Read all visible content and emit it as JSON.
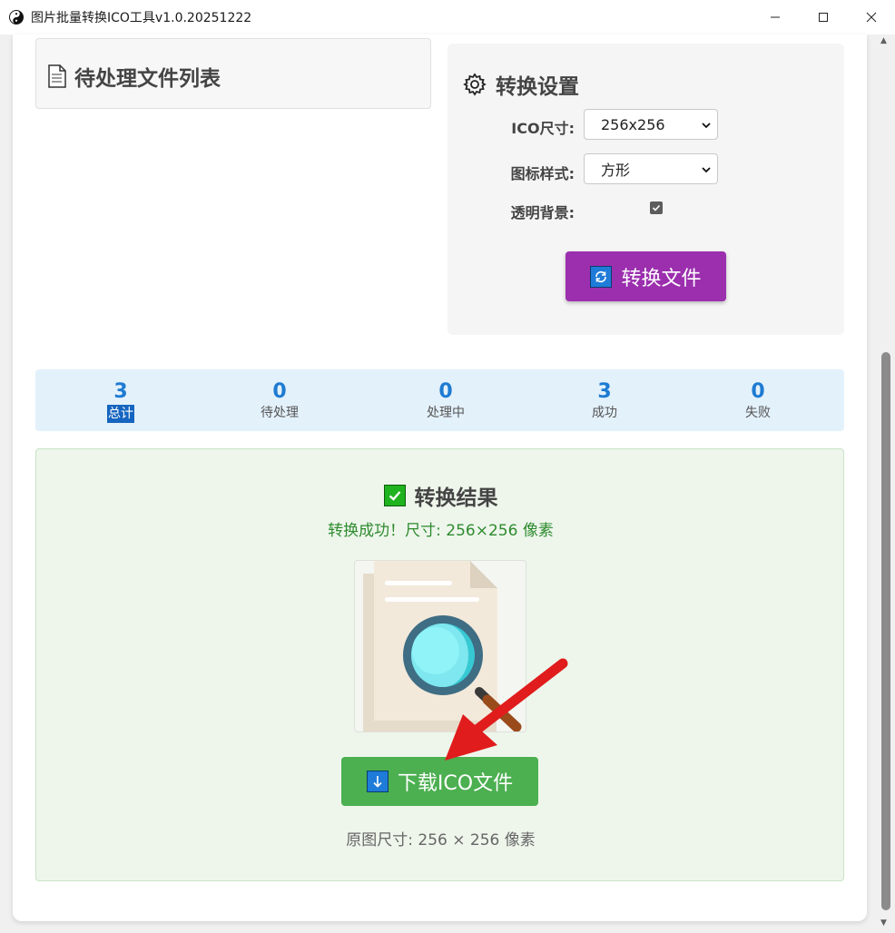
{
  "window": {
    "title": "图片批量转换ICO工具v1.0.20251222",
    "app_icon": "yin-yang-icon"
  },
  "file_list": {
    "title": "待处理文件列表",
    "icon": "document-icon"
  },
  "settings": {
    "title": "转换设置",
    "icon": "gear-icon",
    "ico_size": {
      "label": "ICO尺寸:",
      "value": "256x256"
    },
    "icon_style": {
      "label": "图标样式:",
      "value": "方形"
    },
    "transparent_bg": {
      "label": "透明背景:",
      "checked": true
    },
    "convert_button": "转换文件"
  },
  "stats": [
    {
      "value": "3",
      "label": "总计"
    },
    {
      "value": "0",
      "label": "待处理"
    },
    {
      "value": "0",
      "label": "处理中"
    },
    {
      "value": "3",
      "label": "成功"
    },
    {
      "value": "0",
      "label": "失败"
    }
  ],
  "result": {
    "title": "转换结果",
    "message": "转换成功！尺寸: 256×256 像素",
    "preview_icon": "document-search-icon",
    "download_button": "下载ICO文件",
    "original_size": "原图尺寸: 256 × 256 像素"
  },
  "colors": {
    "convert_button": "#9b2fae",
    "download_button": "#4caf50",
    "stats_number": "#1e7bd2",
    "success_text": "#2e8b2e"
  }
}
